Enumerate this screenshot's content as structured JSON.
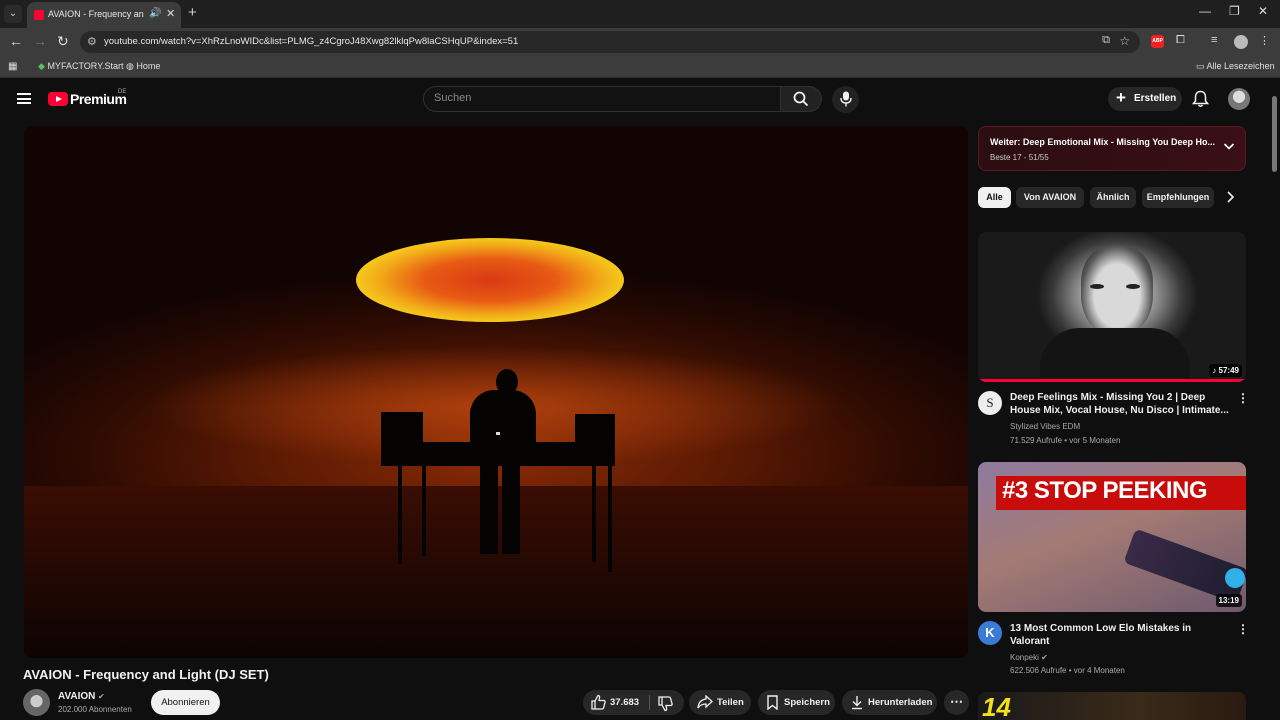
{
  "browser": {
    "tab": {
      "title": "AVAION - Frequency and Li",
      "audio_icon": "speaker-icon",
      "close": "✕"
    },
    "new_tab": "+",
    "window_controls": [
      "—",
      "❐",
      "✕"
    ],
    "url": "youtube.com/watch?v=XhRzLnoWIDc&list=PLMG_z4CgroJ48Xwg82lklqPw8laCSHqUP&index=51",
    "bookmarks": [
      {
        "label": "MYFACTORY.Start",
        "icon": "myfactory-icon"
      },
      {
        "label": "Home",
        "icon": "globe-icon"
      }
    ],
    "all_bookmarks": "Alle Lesezeichen",
    "adblock_label": "ABP"
  },
  "youtube": {
    "brand": "Premium",
    "region": "DE",
    "search_placeholder": "Suchen",
    "create_label": "Erstellen"
  },
  "video": {
    "title": "AVAION - Frequency and Light (DJ SET)",
    "channel": "AVAION",
    "subscribers": "202.000 Abonnenten",
    "subscribe_label": "Abonnieren",
    "likes": "37.683",
    "share_label": "Teilen",
    "save_label": "Speichern",
    "download_label": "Herunterladen"
  },
  "playlist": {
    "title": "Weiter: Deep Emotional Mix - Missing You Deep Ho...",
    "subtitle": "Beste 17 - 51/55"
  },
  "chips": [
    "Alle",
    "Von AVAION",
    "Ähnlich",
    "Empfehlungen"
  ],
  "related": [
    {
      "title": "Deep Feelings Mix - Missing You 2 | Deep House Mix, Vocal House, Nu Disco | Intimate...",
      "channel": "Stylized Vibes EDM",
      "meta": "71.529 Aufrufe • vor 5 Monaten",
      "duration": "♪ 57:49",
      "avatar_letter": "S",
      "thumb_text": ""
    },
    {
      "title": "13 Most Common Low Elo Mistakes in Valorant",
      "channel": "Konpeki",
      "meta": "622.506 Aufrufe • vor 4 Monaten",
      "duration": "13:19",
      "avatar_letter": "K",
      "thumb_text": "#3 STOP PEEKING"
    },
    {
      "thumb_text": "14"
    }
  ],
  "colors": {
    "accent": "#ff0033",
    "background": "#0f0f0f",
    "chip": "#272727"
  }
}
